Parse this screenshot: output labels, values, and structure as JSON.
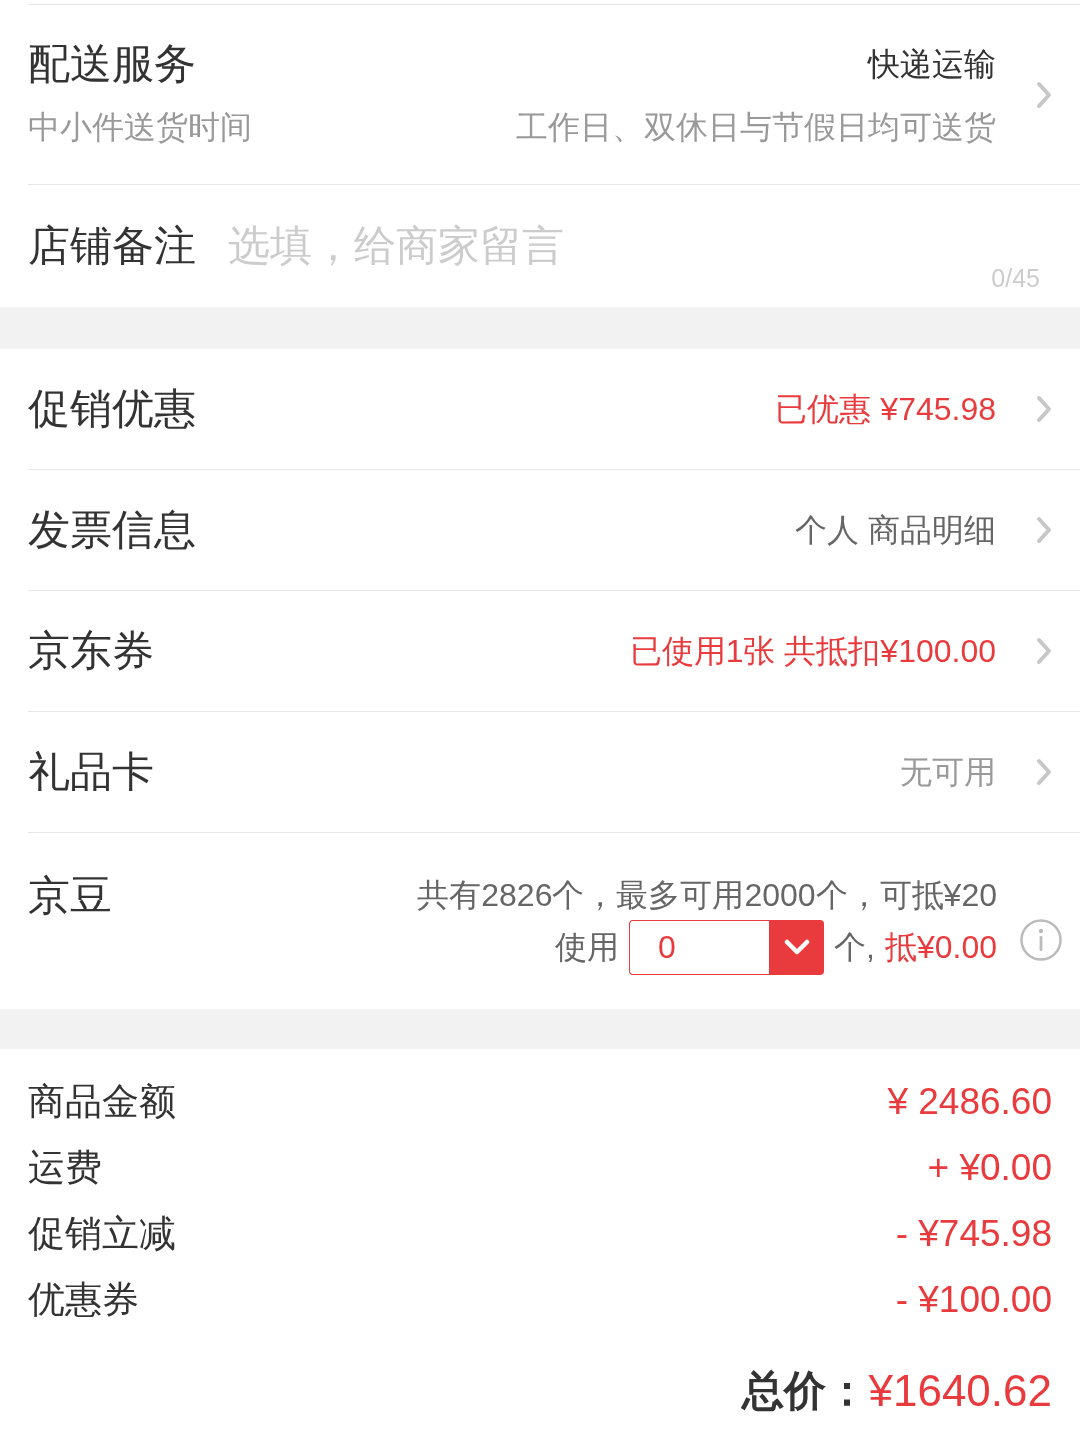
{
  "delivery": {
    "title": "配送服务",
    "method": "快递运输",
    "time_label": "中小件送货时间",
    "time_note": "工作日、双休日与节假日均可送货"
  },
  "remark": {
    "label": "店铺备注",
    "placeholder": "选填，给商家留言",
    "counter": "0/45"
  },
  "options": [
    {
      "label": "促销优惠",
      "value": "已优惠 ¥745.98",
      "color": "#e93b3d"
    },
    {
      "label": "发票信息",
      "value": "个人 商品明细",
      "color": "#666666"
    },
    {
      "label": "京东券",
      "value": "已使用1张 共抵扣¥100.00",
      "color": "#e93b3d"
    },
    {
      "label": "礼品卡",
      "value": "无可用",
      "color": "#999999"
    }
  ],
  "beans": {
    "label": "京豆",
    "summary": "共有2826个，最多可用2000个，可抵¥20",
    "use_label": "使用",
    "quantity": "0",
    "unit": "个,",
    "deduction": "抵¥0.00"
  },
  "summary": {
    "lines": [
      {
        "label": "商品金额",
        "amount": "¥ 2486.60"
      },
      {
        "label": "运费",
        "amount": "+ ¥0.00"
      },
      {
        "label": "促销立减",
        "amount": "- ¥745.98"
      },
      {
        "label": "优惠券",
        "amount": "- ¥100.00"
      }
    ],
    "total_label": "总价：",
    "total": "¥1640.62"
  }
}
